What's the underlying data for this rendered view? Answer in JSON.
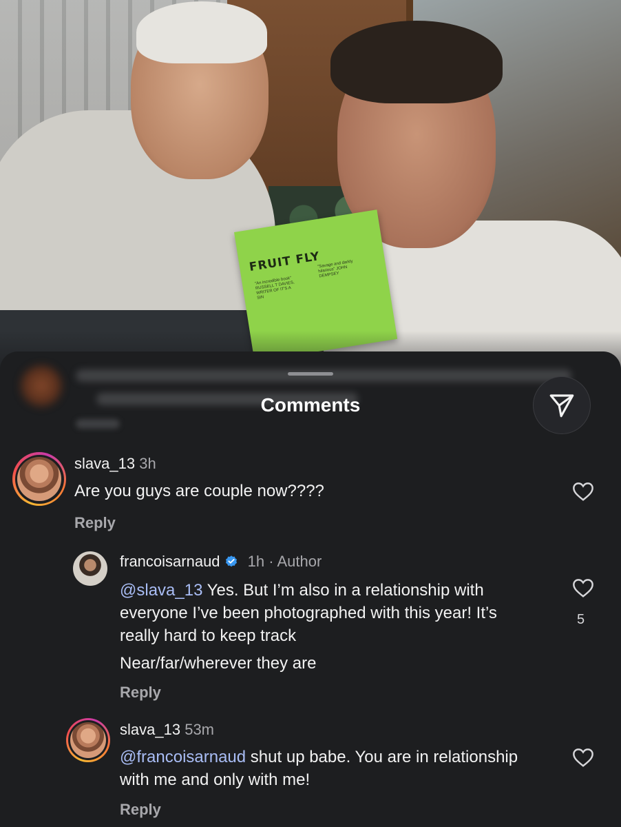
{
  "photo": {
    "book": {
      "title": "FRUIT FLY",
      "blurb_left": "\"An incredible book\" RUSSELL T DAVIES, WRITER OF IT'S A SIN",
      "blurb_right": "\"Savage and darkly hilarious\" JOHN DEMPSEY"
    }
  },
  "sheet": {
    "title": "Comments"
  },
  "comments": [
    {
      "username": "slava_13",
      "time": "3h",
      "author_tag": "",
      "mention": "",
      "text": "Are you guys are couple now????",
      "extra_line": "",
      "reply_label": "Reply",
      "likes": ""
    },
    {
      "username": "francoisarnaud",
      "time": "1h",
      "author_tag": "Author",
      "mention": "@slava_13",
      "text": " Yes. But I’m also in a relationship with everyone I’ve been photographed with this year! It’s really hard to keep track",
      "extra_line": "Near/far/wherever they are",
      "reply_label": "Reply",
      "likes": "5"
    },
    {
      "username": "slava_13",
      "time": "53m",
      "author_tag": "",
      "mention": "@francoisarnaud",
      "text": " shut up babe. You are in relationship with me and only with me!",
      "extra_line": "",
      "reply_label": "Reply",
      "likes": ""
    }
  ],
  "colors": {
    "sheet_bg": "#1d1e20",
    "mention": "#a9bdf5",
    "verified": "#3897f0",
    "muted_text": "#a8a8ac"
  },
  "icons": {
    "share": "paper-plane-icon",
    "like": "heart-outline-icon",
    "verified": "verified-badge-icon"
  }
}
